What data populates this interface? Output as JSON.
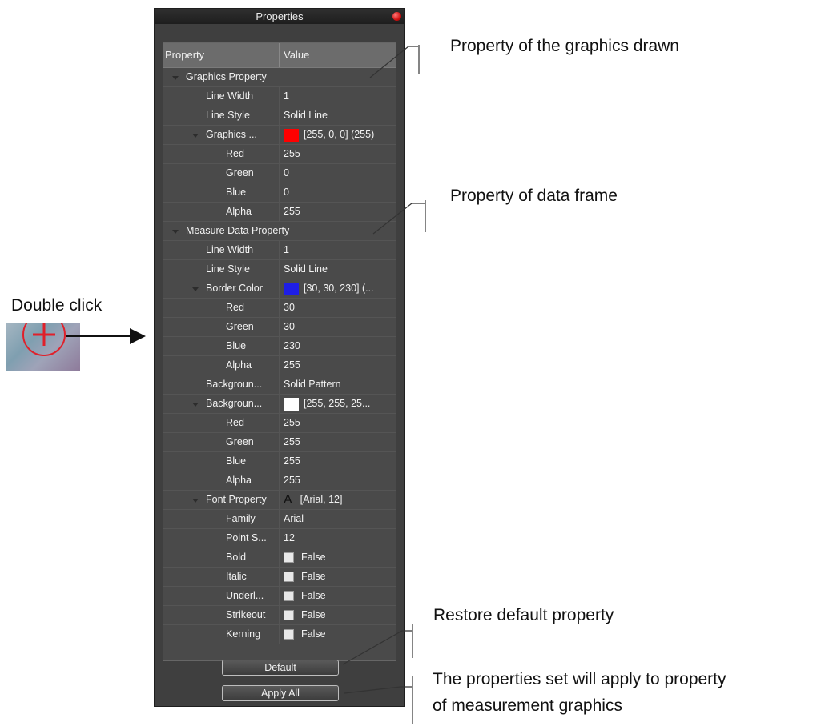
{
  "panel": {
    "title": "Properties",
    "header": {
      "property": "Property",
      "value": "Value"
    },
    "rows": [
      {
        "name": "Graphics Property",
        "value": "",
        "indent": 1,
        "expanded": true
      },
      {
        "name": "Line Width",
        "value": "1",
        "indent": 2
      },
      {
        "name": "Line Style",
        "value": "Solid Line",
        "indent": 2
      },
      {
        "name": "Graphics ...",
        "value": "[255, 0, 0] (255)",
        "indent": 2,
        "expanded": true,
        "swatch": "#ff0000"
      },
      {
        "name": "Red",
        "value": "255",
        "indent": 3
      },
      {
        "name": "Green",
        "value": "0",
        "indent": 3
      },
      {
        "name": "Blue",
        "value": "0",
        "indent": 3
      },
      {
        "name": "Alpha",
        "value": "255",
        "indent": 3
      },
      {
        "name": "Measure Data Property",
        "value": "",
        "indent": 1,
        "expanded": true
      },
      {
        "name": "Line Width",
        "value": "1",
        "indent": 2
      },
      {
        "name": "Line Style",
        "value": "Solid Line",
        "indent": 2
      },
      {
        "name": "Border Color",
        "value": "[30, 30, 230] (...",
        "indent": 2,
        "expanded": true,
        "swatch": "#1e1ee6"
      },
      {
        "name": "Red",
        "value": "30",
        "indent": 3
      },
      {
        "name": "Green",
        "value": "30",
        "indent": 3
      },
      {
        "name": "Blue",
        "value": "230",
        "indent": 3
      },
      {
        "name": "Alpha",
        "value": "255",
        "indent": 3
      },
      {
        "name": "Backgroun...",
        "value": "Solid Pattern",
        "indent": 2
      },
      {
        "name": "Backgroun...",
        "value": "[255, 255, 25...",
        "indent": 2,
        "expanded": true,
        "swatch": "#ffffff"
      },
      {
        "name": "Red",
        "value": "255",
        "indent": 3
      },
      {
        "name": "Green",
        "value": "255",
        "indent": 3
      },
      {
        "name": "Blue",
        "value": "255",
        "indent": 3
      },
      {
        "name": "Alpha",
        "value": "255",
        "indent": 3
      },
      {
        "name": "Font Property",
        "value": "[Arial, 12]",
        "indent": 2,
        "expanded": true,
        "font_icon": "A"
      },
      {
        "name": "Family",
        "value": "Arial",
        "indent": 3
      },
      {
        "name": "Point S...",
        "value": "12",
        "indent": 3
      },
      {
        "name": "Bold",
        "value": "False",
        "indent": 3,
        "checkbox": true
      },
      {
        "name": "Italic",
        "value": "False",
        "indent": 3,
        "checkbox": true
      },
      {
        "name": "Underl...",
        "value": "False",
        "indent": 3,
        "checkbox": true
      },
      {
        "name": "Strikeout",
        "value": "False",
        "indent": 3,
        "checkbox": true
      },
      {
        "name": "Kerning",
        "value": "False",
        "indent": 3,
        "checkbox": true
      }
    ],
    "default_button": "Default",
    "apply_button": "Apply All"
  },
  "annotations": {
    "graphics": "Property of the graphics drawn",
    "data_frame": "Property of data frame",
    "double_click": "Double click",
    "restore": "Restore default property",
    "apply_line1": "The properties set will apply to property",
    "apply_line2": "of measurement graphics"
  }
}
